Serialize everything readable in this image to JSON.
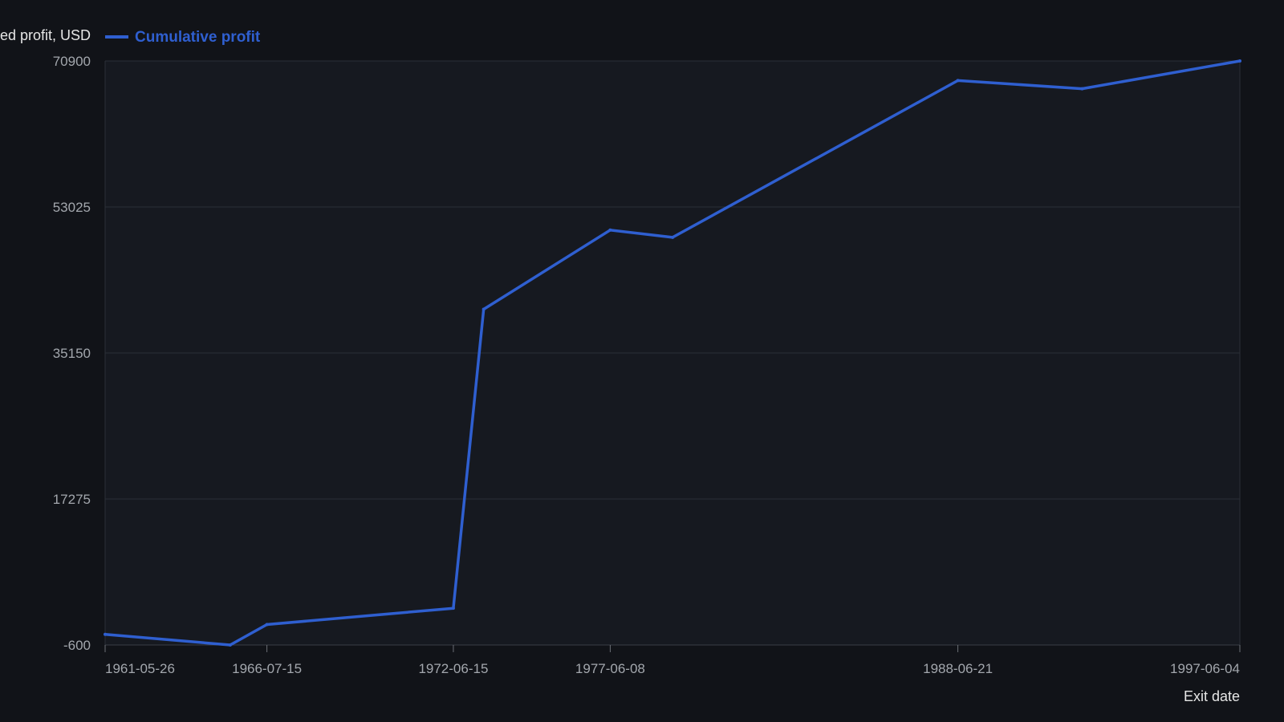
{
  "chart_data": {
    "type": "line",
    "title": "",
    "ylabel": "Realized profit, USD",
    "ylabel_visible": "ed profit, USD",
    "xlabel": "Exit date",
    "ylim": [
      -600,
      70900
    ],
    "y_ticks": [
      "70900",
      "53025",
      "35150",
      "17275",
      "-600"
    ],
    "x_range": [
      "1961-05-26",
      "1997-06-04"
    ],
    "x_ticks": [
      "1961-05-26",
      "1966-07-15",
      "1972-06-15",
      "1977-06-08",
      "1988-06-21",
      "1997-06-04"
    ],
    "grid": true,
    "legend_position": "top-left",
    "series": [
      {
        "name": "Cumulative profit",
        "color": "#2f5fd0",
        "points": [
          {
            "x": "1961-05-26",
            "y": 700
          },
          {
            "x": "1965-05-15",
            "y": -600
          },
          {
            "x": "1966-07-15",
            "y": 1900
          },
          {
            "x": "1972-06-15",
            "y": 3900
          },
          {
            "x": "1973-06-01",
            "y": 40500
          },
          {
            "x": "1977-06-08",
            "y": 50200
          },
          {
            "x": "1979-06-01",
            "y": 49300
          },
          {
            "x": "1988-06-21",
            "y": 68500
          },
          {
            "x": "1992-06-01",
            "y": 67500
          },
          {
            "x": "1997-06-04",
            "y": 70900
          }
        ]
      }
    ]
  }
}
